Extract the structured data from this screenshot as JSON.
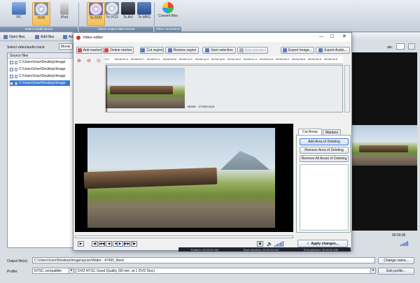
{
  "ribbon": {
    "buttons": [
      {
        "label": "PC",
        "icon": "pc-icon"
      },
      {
        "label": "DVD",
        "icon": "dvd-icon"
      },
      {
        "label": "iPod",
        "icon": "ipod-icon"
      },
      {
        "label": "To DVD",
        "icon": "to-dvd-icon"
      },
      {
        "label": "To VCD",
        "icon": "to-vcd-icon"
      },
      {
        "label": "To AVI",
        "icon": "to-avi-icon"
      },
      {
        "label": "To MPG",
        "icon": "to-mpg-icon"
      },
      {
        "label": "Convert files",
        "icon": "convert-files-icon"
      }
    ],
    "groups": [
      "Select media device",
      "Select output video format",
      "Video conversion"
    ]
  },
  "toolbar": {
    "open_files": "Open files",
    "add_files": "Add files",
    "add_short": "Ad"
  },
  "left": {
    "track_label": "Select video/audio track:",
    "track_value": "Movie",
    "source_header": "Source files",
    "files": [
      "C:\\Users\\User\\Desktop\\Image",
      "C:\\Users\\User\\Desktop\\Image",
      "C:\\Users\\User\\Desktop\\Image",
      "C:\\Users\\User\\Desktop\\Image"
    ]
  },
  "dialog": {
    "title": "Video editor",
    "buttons": {
      "add_marker": "Add marker",
      "delete_marker": "Delete marker",
      "cut_region": "Cut region",
      "restore_region": "Restore region",
      "start_selection": "Start selection",
      "end_selection": "End selection",
      "export_image": "Export Image...",
      "export_audio": "Export Audio..."
    },
    "ruler": [
      "00:00:02.3",
      "00:00:04.7",
      "00:00:07.1",
      "00:00:09.5",
      "00:00:11.9",
      "00:00:14.3",
      "00:00:16.6",
      "00:00:19.0",
      "00:00:21.4",
      "00:00:23.8",
      "00:00:26.2",
      "00:00:28.6",
      "00:00:30.9",
      "00:00:33.3"
    ],
    "ruler_start": "0.0",
    "clip_name": "Water - 47450.mp4",
    "tabs": [
      "Cut Areas",
      "Markers"
    ],
    "side_buttons": {
      "add": "Add Area of Deleting",
      "remove": "Remove Area of Deleting",
      "remove_all": "Remove All Areas of Deleting"
    },
    "apply": "Apply changes...",
    "status": {
      "position": "Position: 00:00:00.040",
      "start": "Start selection: 00:00:00.040",
      "end": "End selection: 00:00:00.040"
    }
  },
  "right": {
    "scale_label": "ale:",
    "time": "00:00:35",
    "edit_label": "Edit"
  },
  "bottom": {
    "output_label": "Output file(s):",
    "output_value": "C:\\Users\\User\\Desktop\\Image\\ayuso\\Water - 47450_New\\",
    "change_name": "Change name...",
    "profile_label": "Profile:",
    "profile_format": "NTSC compatible",
    "profile_value": "DVD NTSC Good Quality (90 min. at 1 DVD Disc)",
    "edit_profile": "Edit profile..."
  }
}
